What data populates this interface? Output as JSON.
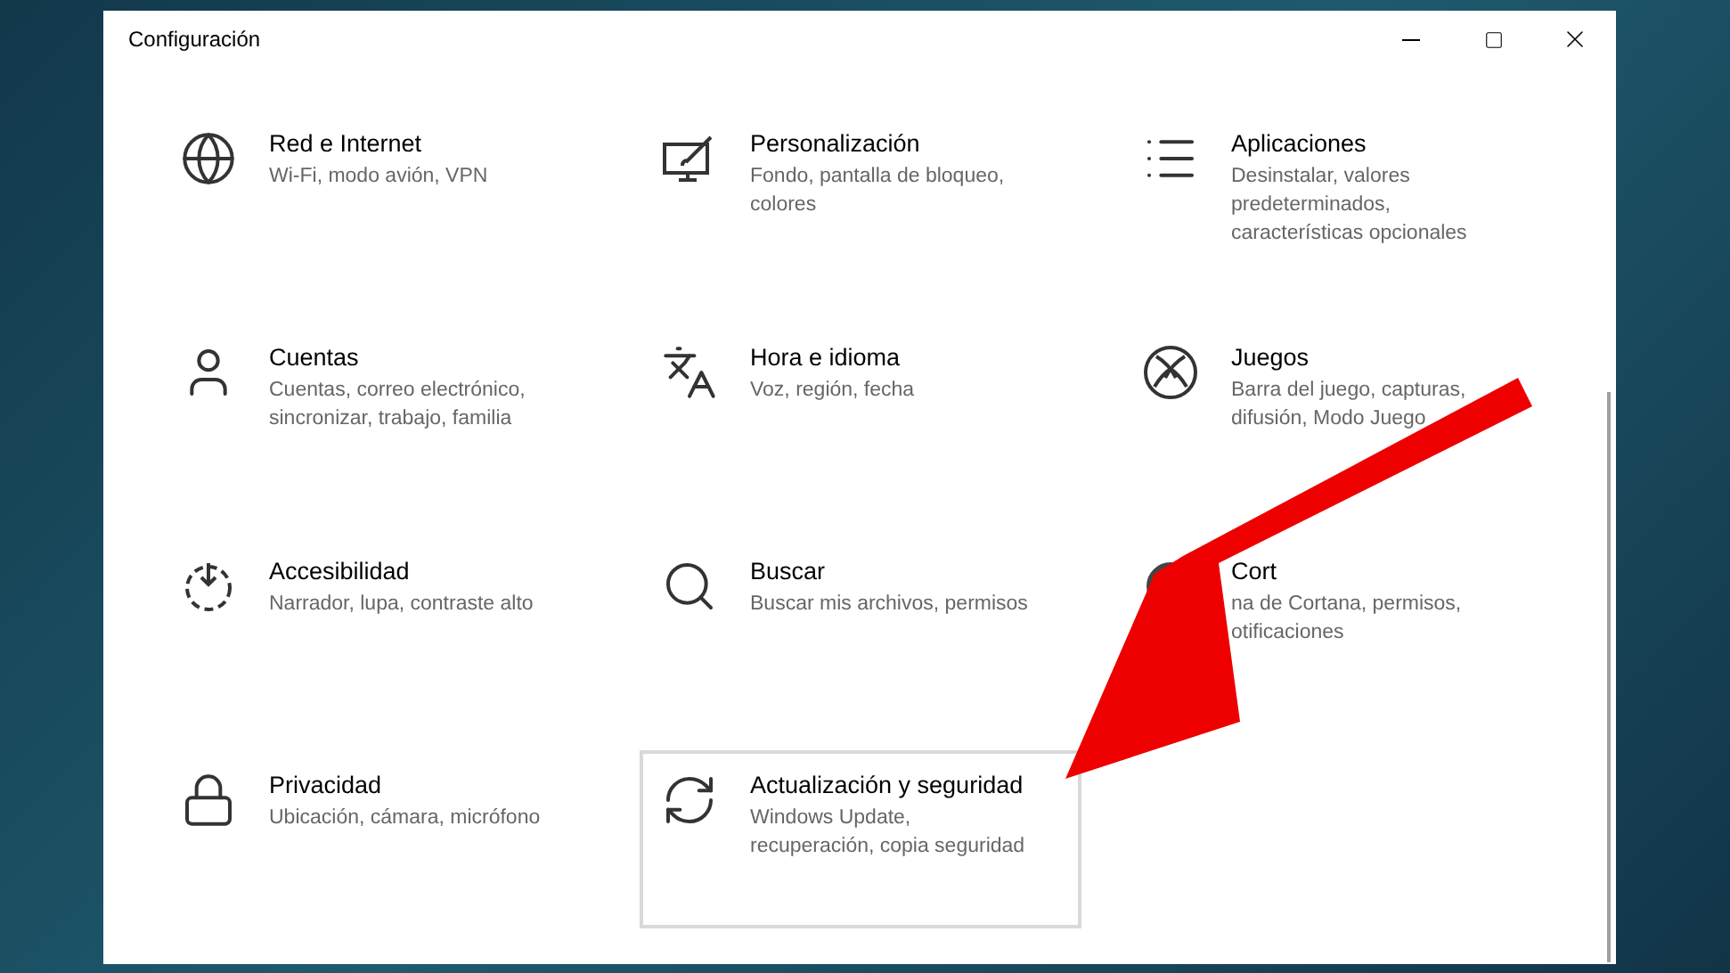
{
  "window": {
    "title": "Configuración"
  },
  "items": [
    {
      "title": "Red e Internet",
      "description": "Wi-Fi, modo avión, VPN",
      "highlighted": false
    },
    {
      "title": "Personalización",
      "description": "Fondo, pantalla de bloqueo, colores",
      "highlighted": false
    },
    {
      "title": "Aplicaciones",
      "description": "Desinstalar, valores predeterminados, características opcionales",
      "highlighted": false
    },
    {
      "title": "Cuentas",
      "description": "Cuentas, correo electrónico, sincronizar, trabajo, familia",
      "highlighted": false
    },
    {
      "title": "Hora e idioma",
      "description": "Voz, región, fecha",
      "highlighted": false
    },
    {
      "title": "Juegos",
      "description": "Barra del juego, capturas, difusión, Modo Juego",
      "highlighted": false
    },
    {
      "title": "Accesibilidad",
      "description": "Narrador, lupa, contraste alto",
      "highlighted": false
    },
    {
      "title": "Buscar",
      "description": "Buscar mis archivos, permisos",
      "highlighted": false
    },
    {
      "title": "Cort",
      "description": "na de Cortana, permisos, otificaciones",
      "highlighted": false
    },
    {
      "title": "Privacidad",
      "description": "Ubicación, cámara, micrófono",
      "highlighted": false
    },
    {
      "title": "Actualización y seguridad",
      "description": "Windows Update, recuperación, copia seguridad",
      "highlighted": true
    }
  ]
}
